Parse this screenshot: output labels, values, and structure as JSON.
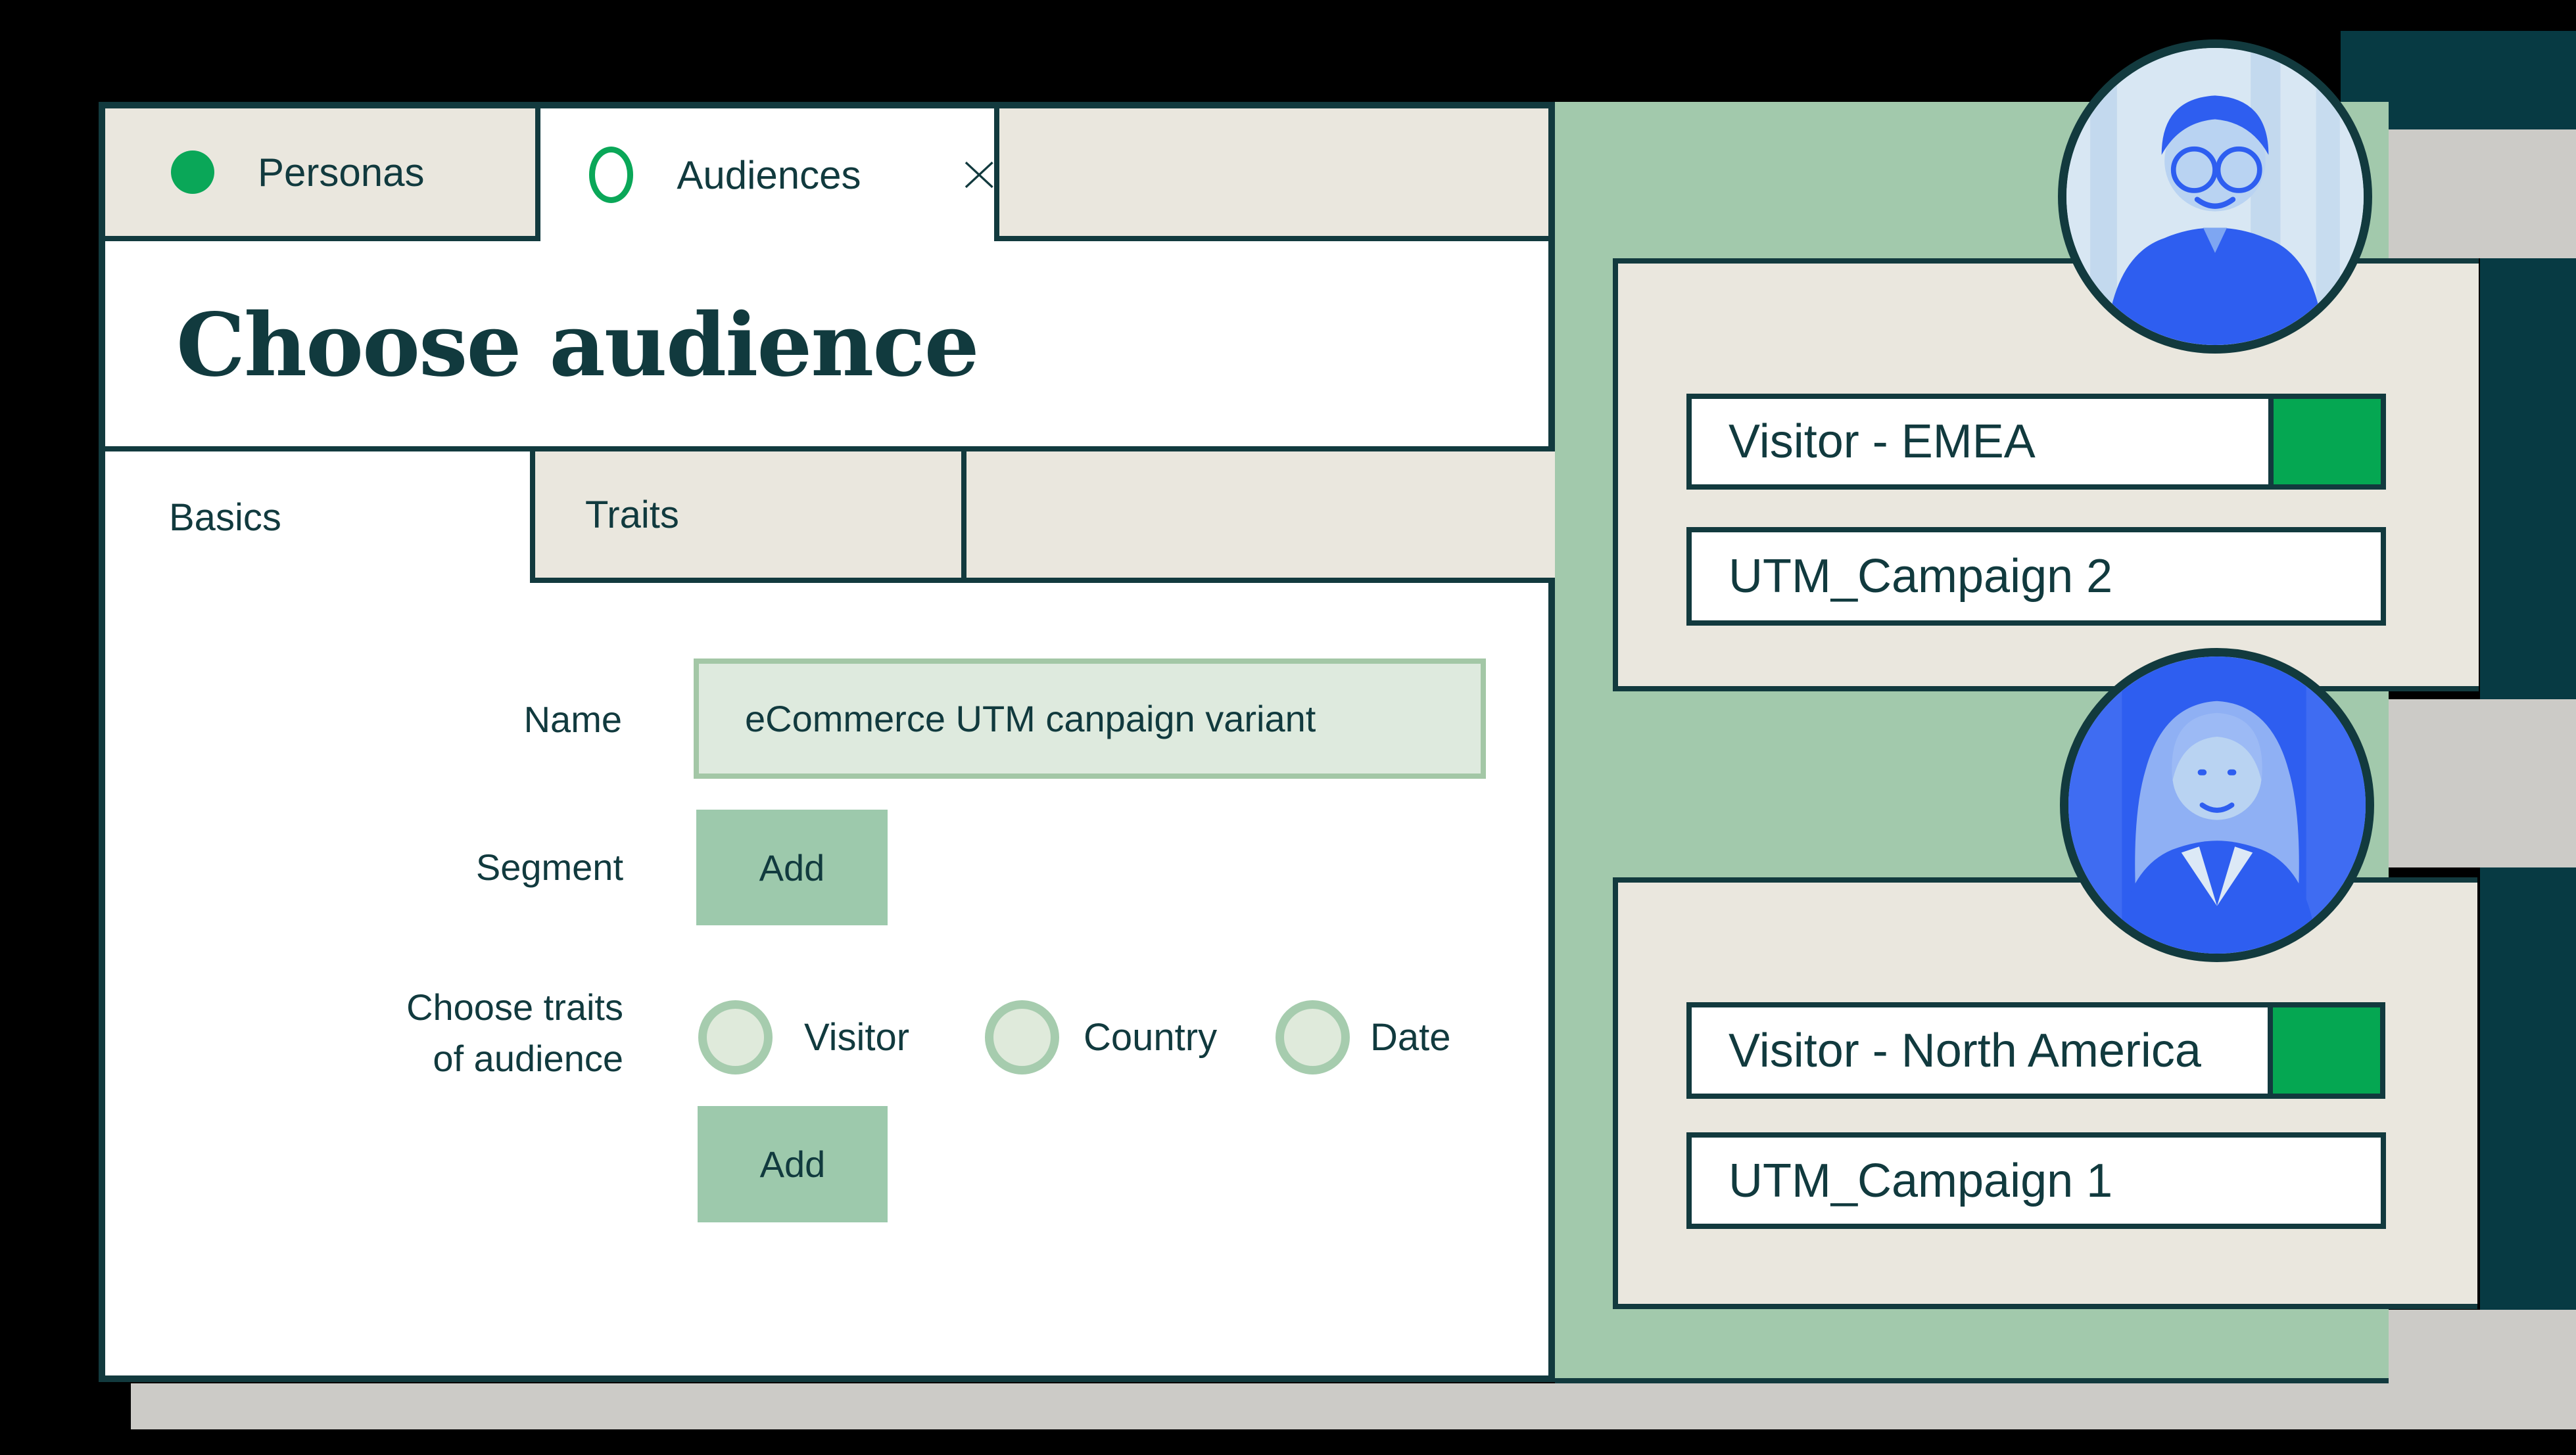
{
  "tabs": {
    "personas_label": "Personas",
    "audiences_label": "Audiences"
  },
  "dialog": {
    "title": "Choose audience",
    "subtabs": {
      "basics_label": "Basics",
      "traits_label": "Traits"
    },
    "form": {
      "name_label": "Name",
      "name_value": "eCommerce UTM canpaign variant",
      "segment_label": "Segment",
      "segment_add_label": "Add",
      "traits_label_line1": "Choose traits",
      "traits_label_line2": "of audience",
      "trait_options": [
        "Visitor",
        "Country",
        "Date"
      ],
      "traits_add_label": "Add"
    }
  },
  "audience_cards": [
    {
      "visitor_label": "Visitor - EMEA",
      "campaign_label": "UTM_Campaign 2",
      "avatar": "man-avatar"
    },
    {
      "visitor_label": "Visitor - North America",
      "campaign_label": "UTM_Campaign 1",
      "avatar": "woman-avatar"
    }
  ],
  "colors": {
    "background": "#000000",
    "dark_teal_border": "#123a3e",
    "teal_band": "#073a43",
    "sage_panel": "#a2c9ac",
    "sage_button": "#9dc9ac",
    "beige": "#eae7de",
    "gray_block": "#cccbc7",
    "accent_green": "#0aa758",
    "input_fill": "#deeade",
    "input_border": "#a3c7a6",
    "avatar_blue": "#2e5ef0"
  }
}
